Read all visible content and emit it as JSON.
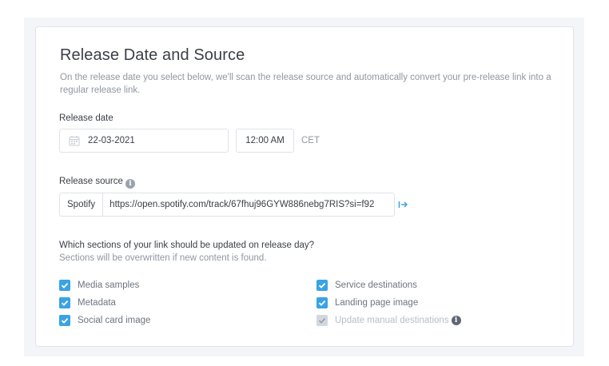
{
  "section": {
    "title": "Release Date and Source",
    "description": "On the release date you select below, we'll scan the release source and automatically convert your pre-release link into a regular release link."
  },
  "release_date": {
    "label": "Release date",
    "date_value": "22-03-2021",
    "time_value": "12:00 AM",
    "timezone": "CET",
    "calendar_icon": "calendar-icon"
  },
  "release_source": {
    "label": "Release source",
    "info_icon": "info-icon",
    "service": "Spotify",
    "url": "https://open.spotify.com/track/67fhuj96GYW886nebg7RIS?si=f92",
    "open_icon": "external-link-arrow-icon"
  },
  "sections_question": {
    "title": "Which sections of your link should be updated on release day?",
    "subtitle": "Sections will be overwritten if new content is found."
  },
  "checkboxes": [
    {
      "label": "Media samples",
      "checked": true,
      "disabled": false
    },
    {
      "label": "Metadata",
      "checked": true,
      "disabled": false
    },
    {
      "label": "Social card image",
      "checked": true,
      "disabled": false
    },
    {
      "label": "Service destinations",
      "checked": true,
      "disabled": false
    },
    {
      "label": "Landing page image",
      "checked": true,
      "disabled": false
    },
    {
      "label": "Update manual destinations",
      "checked": true,
      "disabled": true
    }
  ],
  "colors": {
    "accent": "#3aa3e3",
    "disabled_check": "#d3d8de",
    "text_primary": "#3a3f47",
    "text_muted": "#8f97a1"
  }
}
